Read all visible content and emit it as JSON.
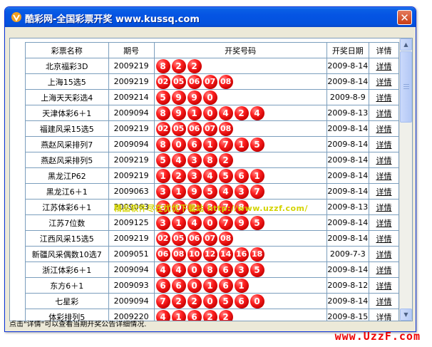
{
  "window": {
    "title": "酷彩网-全国彩票开奖 www.kussq.com",
    "close_label": "✕"
  },
  "table": {
    "headers": [
      "彩票名称",
      "期号",
      "开奖号码",
      "开奖日期",
      "详情"
    ],
    "rows": [
      {
        "name": "北京福彩3D",
        "issue": "2009219",
        "numbers": [
          "8",
          "2",
          "2"
        ],
        "date": "2009-8-14",
        "detail": "详情"
      },
      {
        "name": "上海15选5",
        "issue": "2009219",
        "numbers": [
          "02",
          "05",
          "06",
          "07",
          "08"
        ],
        "date": "2009-8-14",
        "detail": "详情"
      },
      {
        "name": "上海天天彩选4",
        "issue": "2009214",
        "numbers": [
          "5",
          "9",
          "9",
          "0"
        ],
        "date": "2009-8-9",
        "detail": "详情"
      },
      {
        "name": "天津体彩6＋1",
        "issue": "2009094",
        "numbers": [
          "8",
          "9",
          "1",
          "0",
          "4",
          "2",
          "4"
        ],
        "date": "2009-8-13",
        "detail": "详情"
      },
      {
        "name": "福建风采15选5",
        "issue": "2009219",
        "numbers": [
          "02",
          "05",
          "06",
          "07",
          "08"
        ],
        "date": "2009-8-14",
        "detail": "详情"
      },
      {
        "name": "燕赵风采排列7",
        "issue": "2009094",
        "numbers": [
          "8",
          "0",
          "6",
          "1",
          "7",
          "1",
          "5"
        ],
        "date": "2009-8-14",
        "detail": "详情"
      },
      {
        "name": "燕赵风采排列5",
        "issue": "2009219",
        "numbers": [
          "5",
          "4",
          "3",
          "8",
          "2"
        ],
        "date": "2009-8-14",
        "detail": "详情"
      },
      {
        "name": "黑龙江P62",
        "issue": "2009219",
        "numbers": [
          "1",
          "2",
          "3",
          "4",
          "5",
          "6",
          "1"
        ],
        "date": "2009-8-14",
        "detail": "详情"
      },
      {
        "name": "黑龙江6＋1",
        "issue": "2009063",
        "numbers": [
          "3",
          "1",
          "9",
          "5",
          "4",
          "3",
          "7"
        ],
        "date": "2009-8-14",
        "detail": "详情"
      },
      {
        "name": "江苏体彩6＋1",
        "issue": "2009063",
        "numbers": [
          "6",
          "0",
          "2",
          "8",
          "7",
          "8"
        ],
        "date": "2009-8-13",
        "detail": "详情"
      },
      {
        "name": "江苏7位数",
        "issue": "2009125",
        "numbers": [
          "3",
          "1",
          "4",
          "0",
          "7",
          "9",
          "5"
        ],
        "date": "2009-8-14",
        "detail": "详情"
      },
      {
        "name": "江西风采15选5",
        "issue": "2009219",
        "numbers": [
          "02",
          "05",
          "06",
          "07",
          "08"
        ],
        "date": "2009-8-14",
        "detail": "详情"
      },
      {
        "name": "新疆风采偶数10选7",
        "issue": "2009051",
        "numbers": [
          "06",
          "08",
          "10",
          "12",
          "14",
          "16",
          "18"
        ],
        "date": "2009-7-3",
        "detail": "详情"
      },
      {
        "name": "浙江体彩6＋1",
        "issue": "2009094",
        "numbers": [
          "4",
          "4",
          "0",
          "8",
          "6",
          "3",
          "5"
        ],
        "date": "2009-8-14",
        "detail": "详情"
      },
      {
        "name": "东方6＋1",
        "issue": "2009093",
        "numbers": [
          "6",
          "6",
          "0",
          "1",
          "6",
          "1"
        ],
        "date": "2009-8-12",
        "detail": "详情"
      },
      {
        "name": "七星彩",
        "issue": "2009094",
        "numbers": [
          "7",
          "2",
          "2",
          "0",
          "5",
          "6",
          "0"
        ],
        "date": "2009-8-14",
        "detail": "详情"
      },
      {
        "name": "体彩排列5",
        "issue": "2009220",
        "numbers": [
          "4",
          "1",
          "6",
          "2",
          "2"
        ],
        "date": "2009-8-15",
        "detail": "详情"
      }
    ]
  },
  "status": {
    "text": "点击\"详情\"可以查看当期开奖公告详细情况."
  },
  "watermark": {
    "text": "精品软件尽在优优下载站 http://www.uzzf.com/"
  },
  "site_logo": "www.UzzF.com",
  "colors": {
    "ball": "#e00000",
    "title_bar": "#0554e3",
    "grid_line": "#7b9ebd",
    "logo": "#ee0000"
  }
}
